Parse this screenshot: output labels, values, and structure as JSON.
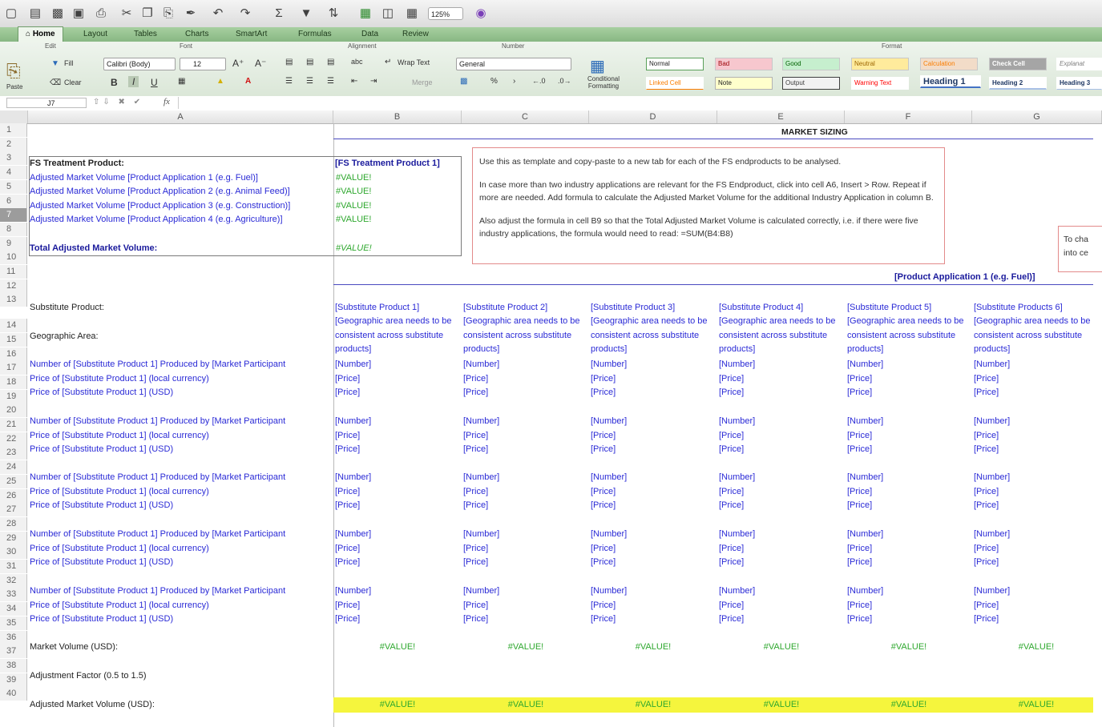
{
  "toolbar": {
    "zoom": "125%",
    "icons": [
      "new-icon",
      "open-icon",
      "save-icon",
      "print-icon",
      "cut-icon",
      "copy-icon",
      "paste-icon",
      "format-painter-icon",
      "undo-icon",
      "redo-icon",
      "autosum-icon",
      "fill-icon",
      "sort-icon",
      "filter-icon",
      "gallery-icon",
      "toolbox-icon",
      "zoom-icon",
      "help-icon"
    ]
  },
  "tabs": [
    "Home",
    "Layout",
    "Tables",
    "Charts",
    "SmartArt",
    "Formulas",
    "Data",
    "Review"
  ],
  "ribbon": {
    "groups": {
      "edit": "Edit",
      "font": "Font",
      "alignment": "Alignment",
      "number": "Number",
      "format": "Format"
    },
    "paste": "Paste",
    "fill": "Fill",
    "clear": "Clear",
    "font_name": "Calibri (Body)",
    "font_size": "12",
    "bold": "B",
    "italic": "I",
    "underline": "U",
    "wrap_text": "Wrap Text",
    "merge": "Merge",
    "abc": "abc",
    "number_format": "General",
    "conditional_formatting": "Conditional Formatting",
    "styles": [
      "Normal",
      "Bad",
      "Good",
      "Neutral",
      "Calculation",
      "Check Cell",
      "Explanat",
      "Linked Cell",
      "Note",
      "Output",
      "Warning Text",
      "Heading 1",
      "Heading 2",
      "Heading 3"
    ]
  },
  "formula_bar": {
    "cell_ref": "J7",
    "fx": "fx",
    "value": ""
  },
  "columns": [
    "A",
    "B",
    "C",
    "D",
    "E",
    "F",
    "G"
  ],
  "rows": [
    "1",
    "2",
    "3",
    "4",
    "5",
    "6",
    "7",
    "8",
    "9",
    "10",
    "11",
    "12",
    "13",
    "14",
    "15",
    "16",
    "17",
    "18",
    "19",
    "20",
    "21",
    "22",
    "23",
    "24",
    "25",
    "26",
    "27",
    "28",
    "29",
    "30",
    "31",
    "32",
    "33",
    "34",
    "35",
    "36",
    "37",
    "38",
    "39",
    "40"
  ],
  "sheet": {
    "market_sizing": "MARKET SIZING",
    "a3": "FS Treatment Product:",
    "a4": "Adjusted Market Volume [Product Application 1 (e.g. Fuel)]",
    "a5": "Adjusted Market Volume [Product Application 2 (e.g. Animal Feed)]",
    "a6": "Adjusted Market Volume [Product Application 3 (e.g. Construction)]",
    "a7": "Adjusted Market Volume [Product Application 4 (e.g. Agriculture)]",
    "a9": "Total Adjusted Market Volume:",
    "b3": "[FS Treatment Product 1]",
    "value_err": "#VALUE!",
    "note1": "Use this as template and copy-paste to a new tab for each of the FS endproducts to be analysed.",
    "note2": "In case more than two industry applications are relevant for the FS Endproduct, click into cell A6, Insert > Row. Repeat if more are needed. Add formula to calculate the Adjusted Market Volume for the additional Industry Application in column B.",
    "note3": "Also adjust the formula in cell B9 so that the Total Adjusted Market Volume is calculated correctly, i.e. if there were five industry applications, the formula would need to read: =SUM(B4:B8)",
    "note_side": "To cha into ce",
    "product_application": "[Product Application 1 (e.g. Fuel)]",
    "a13": "Substitute Product:",
    "a14": "Geographic Area:",
    "substitute_products": [
      "[Substitute Product 1]",
      "[Substitute Product 2]",
      "[Substitute Product 3]",
      "[Substitute Product 4]",
      "[Substitute Product 5]",
      "[Substitute Products 6]"
    ],
    "geo_note": "[Geographic area needs to be consistent across substitute products]",
    "num_label": "Number of [Substitute Product 1] Produced by [Market Participant",
    "price_local": "Price of [Substitute Product 1] (local currency)",
    "price_usd": "Price of [Substitute Product 1] (USD)",
    "number": "[Number]",
    "price": "[Price]",
    "a35": "Market Volume (USD):",
    "a37": "Adjustment Factor (0.5 to 1.5)",
    "a39": "Adjusted Market Volume (USD):"
  }
}
